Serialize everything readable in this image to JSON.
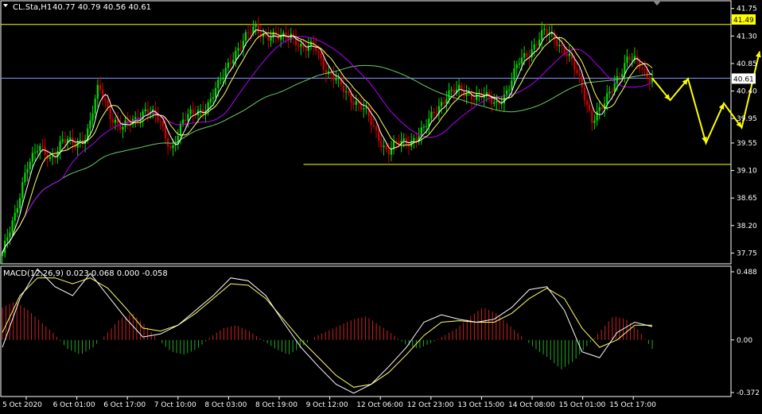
{
  "header": {
    "symbol_label": "CL.Sta,H1",
    "ohlc_label": "40.77 40.79 40.56 40.61"
  },
  "macd_header": {
    "label": "MACD(12,26,9) 0.023 0.068 0.000 -0.058"
  },
  "colors": {
    "background": "#000000",
    "frame": "#ffffff",
    "bull_candle": "#00dd00",
    "bear_candle": "#cc0000",
    "ma_fast": "#ffffff",
    "ma_yellow": "#ffff66",
    "ma_purple": "#b400ff",
    "ma_green": "#66cc66",
    "level_line": "#ffff00",
    "projection": "#ffff00",
    "price_line": "#8899ff",
    "macd_hist_pos": "#cc2222",
    "macd_hist_neg": "#22aa22",
    "macd_line": "#ffffff",
    "signal_line": "#ffff66"
  },
  "chart_data": [
    {
      "type": "candlestick",
      "panel": "price",
      "ylim": [
        37.6,
        41.85
      ],
      "y_ticks": [
        "41.75",
        "41.30",
        "40.85",
        "40.40",
        "39.95",
        "39.55",
        "39.10",
        "38.65",
        "38.20",
        "37.75"
      ],
      "price_badge": "40.61",
      "level_badge": "41.49",
      "horizontal_levels": [
        41.49,
        39.2
      ],
      "current_price": 40.61,
      "close_path": [
        37.75,
        38.3,
        39.2,
        39.45,
        39.3,
        39.6,
        39.5,
        39.7,
        40.45,
        40.0,
        39.8,
        39.9,
        40.15,
        39.9,
        39.45,
        39.9,
        40.05,
        40.15,
        40.5,
        40.95,
        41.2,
        41.45,
        41.3,
        41.25,
        41.35,
        41.05,
        41.15,
        40.7,
        40.5,
        40.3,
        40.1,
        39.75,
        39.4,
        39.55,
        39.6,
        39.75,
        40.1,
        40.35,
        40.4,
        40.35,
        40.3,
        40.2,
        40.4,
        40.9,
        41.1,
        41.35,
        41.25,
        41.0,
        40.55,
        39.95,
        40.15,
        40.6,
        40.95,
        40.8,
        40.61
      ],
      "projection": [
        40.61,
        40.25,
        40.6,
        39.55,
        40.2,
        39.8,
        41.05
      ],
      "x_tick_labels": [
        "5 Oct 2020",
        "6 Oct 01:00",
        "6 Oct 17:00",
        "7 Oct 10:00",
        "8 Oct 03:00",
        "8 Oct 19:00",
        "9 Oct 12:00",
        "12 Oct 06:00",
        "12 Oct 23:00",
        "13 Oct 15:00",
        "14 Oct 08:00",
        "15 Oct 01:00",
        "15 Oct 17:00"
      ]
    },
    {
      "type": "bar",
      "panel": "macd",
      "ylim": [
        -0.372,
        0.488
      ],
      "y_ticks": [
        "0.488",
        "0.00",
        "-0.372"
      ],
      "macd_path": [
        -0.05,
        0.28,
        0.48,
        0.36,
        0.3,
        0.45,
        0.3,
        0.15,
        0.02,
        0.04,
        0.1,
        0.2,
        0.3,
        0.42,
        0.4,
        0.3,
        0.12,
        -0.05,
        -0.18,
        -0.3,
        -0.36,
        -0.3,
        -0.18,
        -0.05,
        0.12,
        0.17,
        0.14,
        0.12,
        0.14,
        0.22,
        0.34,
        0.36,
        0.2,
        -0.08,
        -0.12,
        0.05,
        0.12,
        0.09
      ],
      "signal_path": [
        0.05,
        0.3,
        0.42,
        0.42,
        0.38,
        0.42,
        0.35,
        0.22,
        0.08,
        0.06,
        0.1,
        0.18,
        0.28,
        0.38,
        0.37,
        0.28,
        0.14,
        0.0,
        -0.12,
        -0.24,
        -0.32,
        -0.3,
        -0.22,
        -0.1,
        0.03,
        0.12,
        0.13,
        0.12,
        0.12,
        0.18,
        0.28,
        0.35,
        0.28,
        0.08,
        -0.05,
        0.0,
        0.1,
        0.1
      ],
      "histogram": [
        0.22,
        0.26,
        0.2,
        0.12,
        0.04,
        -0.06,
        -0.1,
        -0.05,
        0.04,
        0.14,
        0.18,
        0.1,
        0.0,
        -0.08,
        -0.1,
        -0.06,
        0.02,
        0.08,
        0.1,
        0.06,
        0.0,
        -0.06,
        -0.1,
        -0.05,
        0.02,
        0.06,
        0.1,
        0.14,
        0.16,
        0.1,
        0.04,
        -0.03,
        -0.06,
        -0.02,
        0.03,
        0.08,
        0.16,
        0.22,
        0.18,
        0.1,
        0.02,
        -0.06,
        -0.12,
        -0.2,
        -0.14,
        -0.04,
        0.06,
        0.16,
        0.14,
        0.06,
        -0.06
      ]
    }
  ]
}
